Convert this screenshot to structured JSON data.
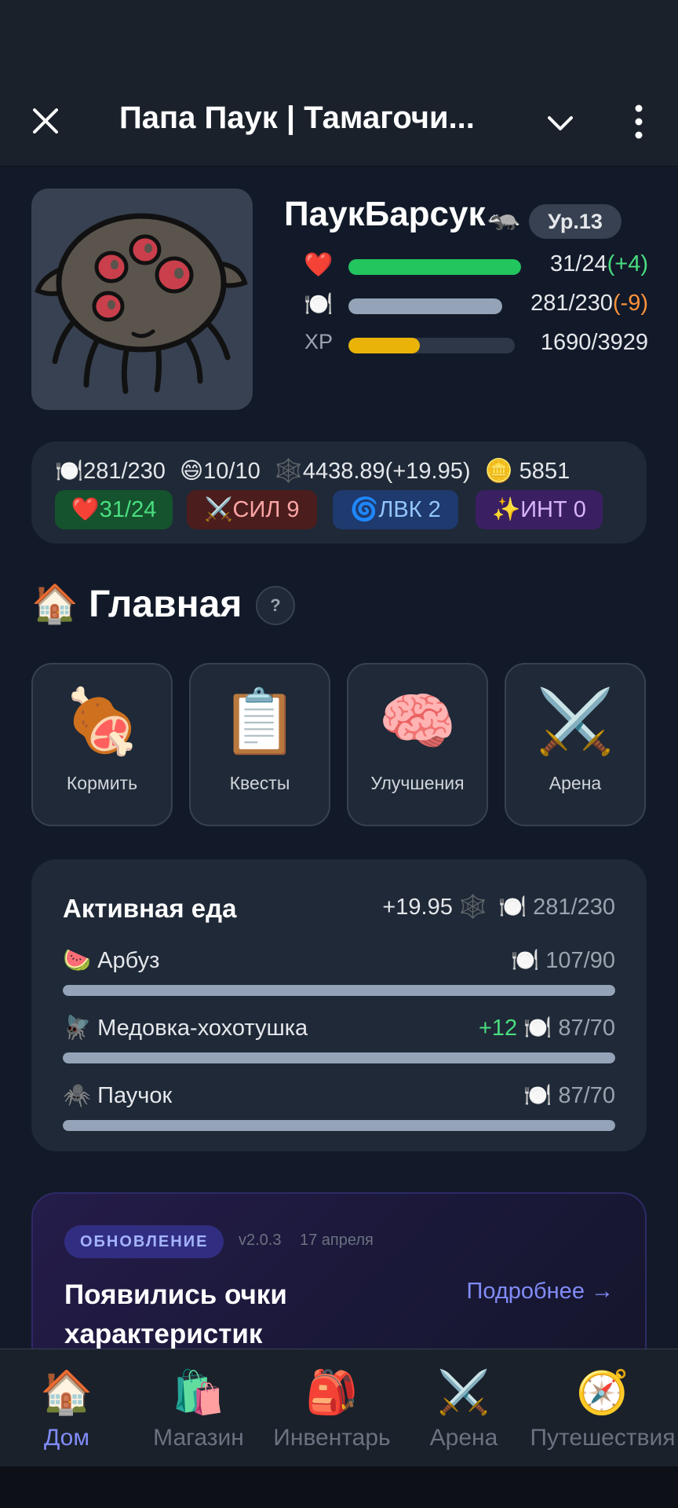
{
  "header": {
    "title": "Папа Паук | Тамагочи...",
    "close_icon": "close-icon",
    "dropdown_icon": "chevron-down-icon",
    "menu_icon": "more-vertical-icon"
  },
  "pet": {
    "name": "ПаукБарсук",
    "name_emoji": "🦡",
    "level": "Ур.13",
    "health": {
      "icon": "❤️",
      "value": "31/24",
      "delta": "(+4)",
      "fill": 1.0,
      "color": "#22c55e"
    },
    "food": {
      "icon": "🍽️",
      "value": "281/230",
      "delta": "(-9)",
      "fill": 1.0,
      "color": "#94a3b8"
    },
    "xp": {
      "label": "XP",
      "value": "1690/3929",
      "fill": 0.43,
      "color": "#eab308"
    }
  },
  "resources": {
    "food": "🍽️281/230",
    "mood": "😄10/10",
    "web": "🕸️4438.89(+19.95)",
    "coins": "🪙 5851"
  },
  "chips": [
    {
      "text": "❤️31/24",
      "bg": "#14532d",
      "fg": "#4ade80"
    },
    {
      "text": "⚔️СИЛ 9",
      "bg": "#4c1d1d",
      "fg": "#fca5a5"
    },
    {
      "text": "🌀ЛВК 2",
      "bg": "#1e3a6e",
      "fg": "#93c5fd"
    },
    {
      "text": "✨ИНТ 0",
      "bg": "#3b1f63",
      "fg": "#d8b4fe"
    }
  ],
  "section": {
    "icon": "🏠",
    "title": "Главная",
    "help": "?"
  },
  "tiles": [
    {
      "icon": "🍖",
      "label": "Кормить"
    },
    {
      "icon": "📋",
      "label": "Квесты"
    },
    {
      "icon": "🧠",
      "label": "Улучшения"
    },
    {
      "icon": "⚔️",
      "label": "Арена"
    }
  ],
  "active_food": {
    "title": "Активная еда",
    "web_gain": "+19.95 🕸️",
    "total": "🍽️ 281/230",
    "items": [
      {
        "name": "🍉 Арбуз",
        "bonus": "",
        "value": "🍽️ 107/90",
        "fill": 1.0
      },
      {
        "name": "🪰 Медовка-хохотушка",
        "bonus": "+12",
        "value": "🍽️ 87/70",
        "fill": 1.0
      },
      {
        "name": "🕷️ Паучок",
        "bonus": "",
        "value": "🍽️ 87/70",
        "fill": 1.0
      }
    ]
  },
  "update": {
    "badge": "ОБНОВЛЕНИЕ",
    "version": "v2.0.3",
    "date": "17 апреля",
    "title": "Появились очки характеристик",
    "more": "Подробнее →"
  },
  "nav": [
    {
      "icon": "🏠",
      "label": "Дом",
      "active": true
    },
    {
      "icon": "🛍️",
      "label": "Магазин",
      "active": false
    },
    {
      "icon": "🎒",
      "label": "Инвентарь",
      "active": false
    },
    {
      "icon": "⚔️",
      "label": "Арена",
      "active": false
    },
    {
      "icon": "🧭",
      "label": "Путешествия",
      "active": false
    }
  ]
}
